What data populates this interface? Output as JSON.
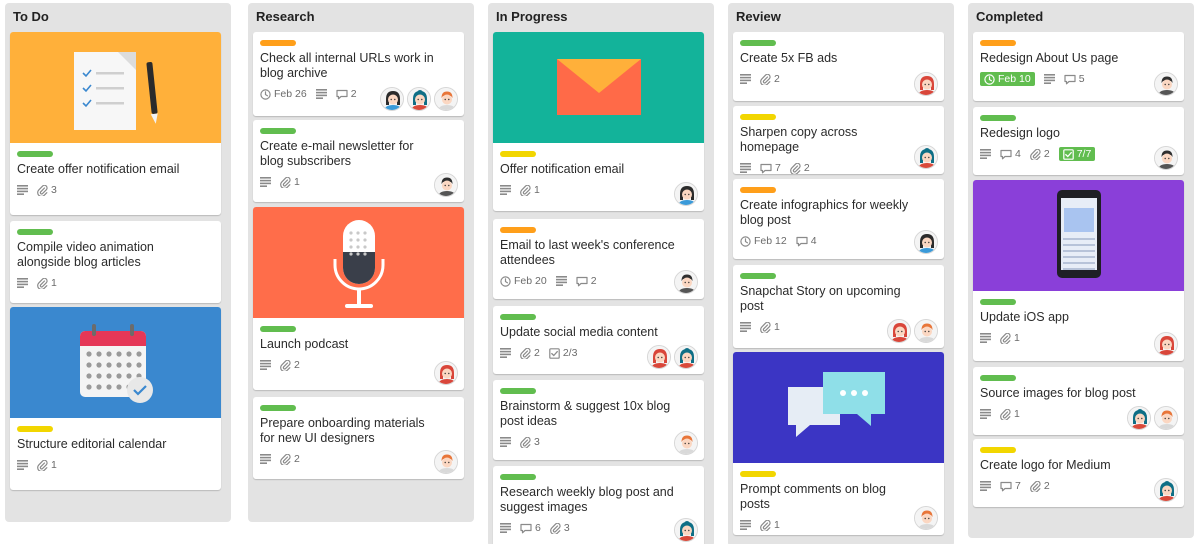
{
  "lists": [
    {
      "title": "To Do",
      "cards": [
        {
          "cover": "offer-document-cover",
          "cover_color": "#ffb03a",
          "labels": [
            "green"
          ],
          "title": "Create offer notification email",
          "desc": true,
          "attachments": "3",
          "members": []
        },
        {
          "labels": [
            "green"
          ],
          "title": "Compile video animation alongside blog articles",
          "desc": true,
          "attachments": "1",
          "members": []
        },
        {
          "cover": "calendar-cover",
          "cover_color": "#3a88cf",
          "labels": [
            "yellow"
          ],
          "title": "Structure editorial calendar",
          "desc": true,
          "attachments": "1",
          "members": []
        }
      ]
    },
    {
      "title": "Research",
      "cards": [
        {
          "labels": [
            "orange"
          ],
          "title": "Check all internal URLs work in blog archive",
          "due": "Feb 26",
          "desc": true,
          "comments": "2",
          "members": [
            "female-dark",
            "female-teal",
            "male-ginger"
          ]
        },
        {
          "labels": [
            "green"
          ],
          "title": "Create e-mail newsletter for blog subscribers",
          "desc": true,
          "attachments": "1",
          "members": [
            "male-dark"
          ]
        },
        {
          "cover": "microphone-cover",
          "cover_color": "#ff6d4a",
          "labels": [
            "green"
          ],
          "title": "Launch podcast",
          "desc": true,
          "attachments": "2",
          "members": [
            "female-red"
          ]
        },
        {
          "labels": [
            "green"
          ],
          "title": "Prepare onboarding materials for new UI designers",
          "desc": true,
          "attachments": "2",
          "members": [
            "male-ginger"
          ]
        }
      ]
    },
    {
      "title": "In Progress",
      "cards": [
        {
          "cover": "envelope-cover",
          "cover_color": "#13b39a",
          "labels": [
            "yellow"
          ],
          "title": "Offer notification email",
          "desc": true,
          "attachments": "1",
          "members": [
            "female-dark"
          ]
        },
        {
          "labels": [
            "orange"
          ],
          "title": "Email to last week's conference attendees",
          "due": "Feb 20",
          "desc": true,
          "comments": "2",
          "members": [
            "male-dark"
          ]
        },
        {
          "labels": [
            "green"
          ],
          "title": "Update social media content",
          "desc": true,
          "attachments": "2",
          "checklist": "2/3",
          "members": [
            "female-red",
            "female-teal"
          ]
        },
        {
          "labels": [
            "green"
          ],
          "title": "Brainstorm & suggest 10x blog post ideas",
          "desc": true,
          "attachments": "3",
          "members": [
            "male-ginger"
          ]
        },
        {
          "labels": [
            "green"
          ],
          "title": "Research weekly blog post and suggest images",
          "desc": true,
          "attachments": "3",
          "comments": "6",
          "members": [
            "female-teal"
          ]
        }
      ]
    },
    {
      "title": "Review",
      "cards": [
        {
          "labels": [
            "green"
          ],
          "title": "Create 5x FB ads",
          "desc": true,
          "attachments": "2",
          "members": [
            "female-red"
          ]
        },
        {
          "labels": [
            "yellow"
          ],
          "title": "Sharpen copy across homepage",
          "desc": true,
          "comments": "7",
          "attachments": "2",
          "members": [
            "female-teal"
          ]
        },
        {
          "labels": [
            "orange"
          ],
          "title": "Create infographics for weekly blog post",
          "due": "Feb 12",
          "comments": "4",
          "members": [
            "female-dark"
          ]
        },
        {
          "labels": [
            "green"
          ],
          "title": "Snapchat Story on upcoming post",
          "desc": true,
          "attachments": "1",
          "members": [
            "female-red",
            "male-ginger"
          ]
        },
        {
          "cover": "chat-cover",
          "cover_color": "#3b35c4",
          "labels": [
            "yellow"
          ],
          "title": "Prompt comments on blog posts",
          "desc": true,
          "attachments": "1",
          "members": [
            "male-ginger"
          ]
        }
      ]
    },
    {
      "title": "Completed",
      "cards": [
        {
          "labels": [
            "orange"
          ],
          "title": "Redesign About Us page",
          "due": "Feb 10",
          "due_done": true,
          "desc": true,
          "comments": "5",
          "members": [
            "male-dark"
          ]
        },
        {
          "labels": [
            "green"
          ],
          "title": "Redesign logo",
          "desc": true,
          "comments": "4",
          "attachments": "2",
          "checklist": "7/7",
          "checklist_done": true,
          "members": [
            "male-dark"
          ]
        },
        {
          "cover": "phone-cover",
          "cover_color": "#8a3fd9",
          "labels": [
            "green"
          ],
          "title": "Update iOS app",
          "desc": true,
          "attachments": "1",
          "members": [
            "female-red"
          ]
        },
        {
          "labels": [
            "green"
          ],
          "title": "Source images for blog post",
          "desc": true,
          "attachments": "1",
          "members": [
            "female-teal",
            "male-ginger"
          ]
        },
        {
          "labels": [
            "yellow"
          ],
          "title": "Create logo for Medium",
          "desc": true,
          "comments": "7",
          "attachments": "2",
          "members": [
            "female-teal"
          ]
        }
      ]
    }
  ]
}
